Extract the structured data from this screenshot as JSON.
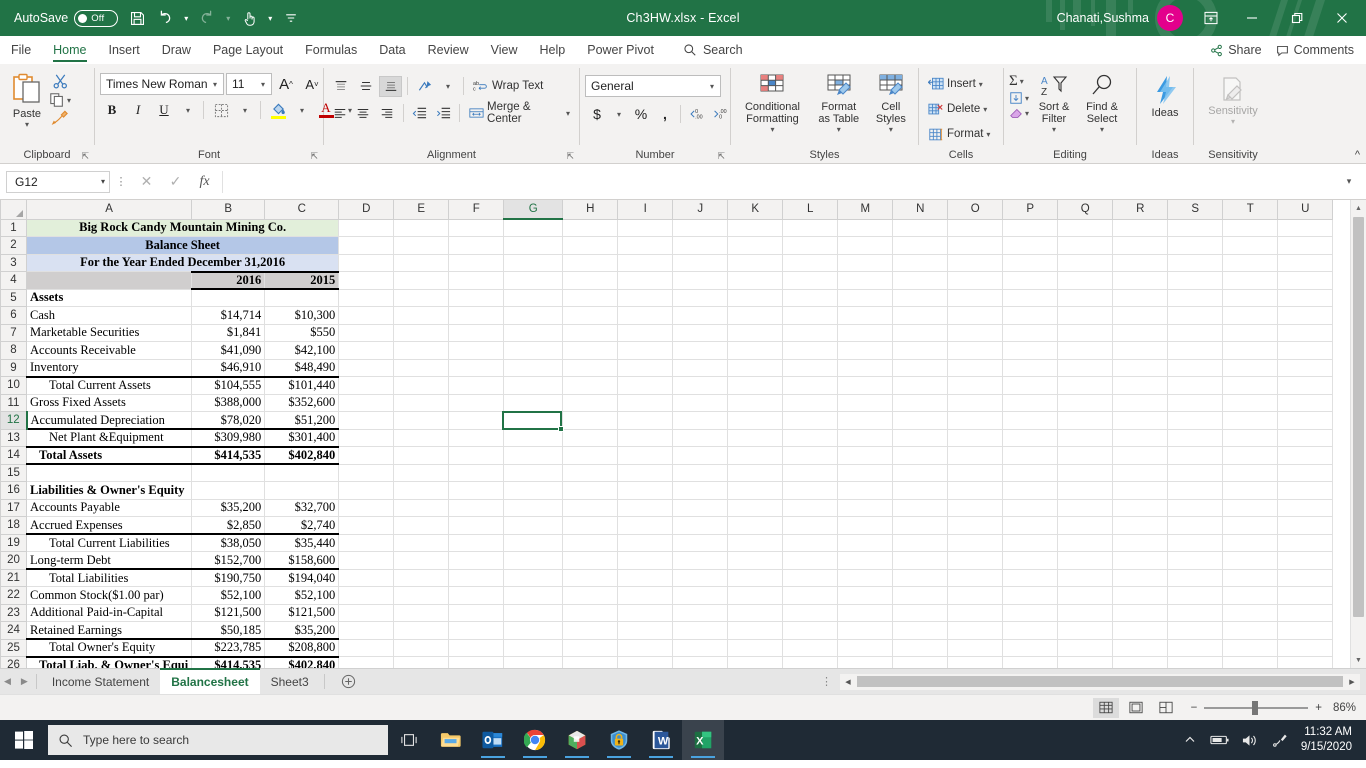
{
  "titlebar": {
    "autosave_label": "AutoSave",
    "autosave_state": "Off",
    "document_title": "Ch3HW.xlsx  -  Excel",
    "username": "Chanati,Sushma",
    "avatar_initial": "C",
    "qat": [
      {
        "name": "save-icon",
        "label": "Save"
      },
      {
        "name": "undo-icon",
        "label": "Undo"
      },
      {
        "name": "redo-icon",
        "label": "Redo"
      },
      {
        "name": "touch-mode-icon",
        "label": "Touch/Mouse Mode"
      },
      {
        "name": "customize-qat-icon",
        "label": "Customize Quick Access Toolbar"
      }
    ],
    "window_buttons": {
      "minimize": "—",
      "restore": "❐",
      "close": "✕"
    },
    "ribbon_display_label": "Ribbon Display Options",
    "accent_color": "#217346",
    "avatar_color": "#e3008c"
  },
  "ribbon_tabs": {
    "items": [
      {
        "label": "File",
        "active": false
      },
      {
        "label": "Home",
        "active": true
      },
      {
        "label": "Insert",
        "active": false
      },
      {
        "label": "Draw",
        "active": false
      },
      {
        "label": "Page Layout",
        "active": false
      },
      {
        "label": "Formulas",
        "active": false
      },
      {
        "label": "Data",
        "active": false
      },
      {
        "label": "Review",
        "active": false
      },
      {
        "label": "View",
        "active": false
      },
      {
        "label": "Help",
        "active": false
      },
      {
        "label": "Power Pivot",
        "active": false
      }
    ],
    "search_placeholder": "Search",
    "share_label": "Share",
    "comments_label": "Comments"
  },
  "ribbon": {
    "clipboard": {
      "group_label": "Clipboard",
      "paste_label": "Paste",
      "cut_label": "Cut",
      "copy_label": "Copy",
      "format_painter_label": "Format Painter"
    },
    "font": {
      "group_label": "Font",
      "font_name": "Times New Roman",
      "font_size": "11",
      "grow_label": "Increase Font Size",
      "shrink_label": "Decrease Font Size",
      "bold_label": "B",
      "italic_label": "I",
      "underline_label": "U",
      "borders_label": "Borders",
      "fill_label": "Fill Color",
      "fontcolor_label": "Font Color"
    },
    "alignment": {
      "group_label": "Alignment",
      "wrap_text_label": "Wrap Text",
      "merge_center_label": "Merge & Center",
      "orientation_label": "Orientation",
      "decrease_indent_label": "Decrease Indent",
      "increase_indent_label": "Increase Indent"
    },
    "number": {
      "group_label": "Number",
      "format": "General",
      "accounting_label": "Accounting Number Format",
      "percent_label": "Percent Style",
      "comma_label": "Comma Style",
      "increase_decimal_label": "Increase Decimal",
      "decrease_decimal_label": "Decrease Decimal"
    },
    "styles": {
      "group_label": "Styles",
      "conditional_formatting_label": "Conditional Formatting",
      "format_as_table_label": "Format as Table",
      "cell_styles_label": "Cell Styles"
    },
    "cells": {
      "group_label": "Cells",
      "insert_label": "Insert",
      "delete_label": "Delete",
      "format_label": "Format"
    },
    "editing": {
      "group_label": "Editing",
      "autosum_label": "AutoSum",
      "fill_label": "Fill",
      "clear_label": "Clear",
      "sort_filter_label": "Sort & Filter",
      "find_select_label": "Find & Select"
    },
    "ideas": {
      "group_label": "Ideas",
      "button_label": "Ideas"
    },
    "sensitivity": {
      "group_label": "Sensitivity",
      "button_label": "Sensitivity"
    }
  },
  "formula_bar": {
    "name_box": "G12",
    "cancel_label": "Cancel",
    "enter_label": "Enter",
    "fx_label": "fx",
    "formula_value": "",
    "expand_label": "Expand Formula Bar"
  },
  "grid": {
    "columns": [
      "A",
      "B",
      "C",
      "D",
      "E",
      "F",
      "G",
      "H",
      "I",
      "J",
      "K",
      "L",
      "M",
      "N",
      "O",
      "P",
      "Q",
      "R",
      "S",
      "T",
      "U"
    ],
    "selected_cell": "G12",
    "selected_column": "G",
    "selected_row": 12,
    "rows": [
      {
        "n": 1,
        "a": "Big Rock Candy Mountain Mining Co.",
        "b": "",
        "c": "",
        "style": "title-green"
      },
      {
        "n": 2,
        "a": "Balance Sheet",
        "b": "",
        "c": "",
        "style": "title-blue1"
      },
      {
        "n": 3,
        "a": "For the Year Ended December 31,2016",
        "b": "",
        "c": "",
        "style": "title-blue2"
      },
      {
        "n": 4,
        "a": "",
        "b": "2016",
        "c": "2015",
        "style": "years"
      },
      {
        "n": 5,
        "a": "Assets",
        "b": "",
        "c": "",
        "style": "section"
      },
      {
        "n": 6,
        "a": "Cash",
        "b": "$14,714",
        "c": "$10,300",
        "style": "item"
      },
      {
        "n": 7,
        "a": "Marketable Securities",
        "b": "$1,841",
        "c": "$550",
        "style": "item"
      },
      {
        "n": 8,
        "a": "Accounts Receivable",
        "b": "$41,090",
        "c": "$42,100",
        "style": "item"
      },
      {
        "n": 9,
        "a": "Inventory",
        "b": "$46,910",
        "c": "$48,490",
        "style": "item"
      },
      {
        "n": 10,
        "a": "Total Current Assets",
        "b": "$104,555",
        "c": "$101,440",
        "style": "subtotal"
      },
      {
        "n": 11,
        "a": "Gross Fixed Assets",
        "b": "$388,000",
        "c": "$352,600",
        "style": "item"
      },
      {
        "n": 12,
        "a": "Accumulated Depreciation",
        "b": "$78,020",
        "c": "$51,200",
        "style": "item"
      },
      {
        "n": 13,
        "a": "Net Plant &Equipment",
        "b": "$309,980",
        "c": "$301,400",
        "style": "subtotal"
      },
      {
        "n": 14,
        "a": "Total Assets",
        "b": "$414,535",
        "c": "$402,840",
        "style": "grandtotal"
      },
      {
        "n": 15,
        "a": "",
        "b": "",
        "c": "",
        "style": "blank"
      },
      {
        "n": 16,
        "a": "Liabilities & Owner's Equity",
        "b": "",
        "c": "",
        "style": "section"
      },
      {
        "n": 17,
        "a": "Accounts Payable",
        "b": "$35,200",
        "c": "$32,700",
        "style": "item"
      },
      {
        "n": 18,
        "a": "Accrued Expenses",
        "b": "$2,850",
        "c": "$2,740",
        "style": "item"
      },
      {
        "n": 19,
        "a": "Total Current Liabilities",
        "b": "$38,050",
        "c": "$35,440",
        "style": "subtotal"
      },
      {
        "n": 20,
        "a": "Long-term Debt",
        "b": "$152,700",
        "c": "$158,600",
        "style": "item"
      },
      {
        "n": 21,
        "a": "Total Liabilities",
        "b": "$190,750",
        "c": "$194,040",
        "style": "subtotal"
      },
      {
        "n": 22,
        "a": "Common Stock($1.00 par)",
        "b": "$52,100",
        "c": "$52,100",
        "style": "item"
      },
      {
        "n": 23,
        "a": "Additional Paid-in-Capital",
        "b": "$121,500",
        "c": "$121,500",
        "style": "item"
      },
      {
        "n": 24,
        "a": "Retained Earnings",
        "b": "$50,185",
        "c": "$35,200",
        "style": "item"
      },
      {
        "n": 25,
        "a": "Total Owner's Equity",
        "b": "$223,785",
        "c": "$208,800",
        "style": "subtotal"
      },
      {
        "n": 26,
        "a": "Total Liab. & Owner's Equi",
        "b": "$414,535",
        "c": "$402,840",
        "style": "grandtotal"
      }
    ]
  },
  "sheet_tabs": {
    "items": [
      {
        "label": "Income Statement",
        "active": false
      },
      {
        "label": "Balancesheet",
        "active": true
      },
      {
        "label": "Sheet3",
        "active": false
      }
    ],
    "add_sheet_label": "+",
    "prev_label": "◀",
    "next_label": "▶"
  },
  "status_bar": {
    "normal_view_label": "Normal",
    "page_layout_label": "Page Layout",
    "page_break_label": "Page Break Preview",
    "zoom_out_label": "−",
    "zoom_in_label": "+",
    "zoom_level": "86%"
  },
  "taskbar": {
    "start_label": "Start",
    "search_placeholder": "Type here to search",
    "task_view_label": "Task View",
    "apps": [
      {
        "name": "file-explorer-icon",
        "label": "File Explorer",
        "running": false
      },
      {
        "name": "outlook-icon",
        "label": "Outlook",
        "running": true
      },
      {
        "name": "chrome-icon",
        "label": "Google Chrome",
        "running": true
      },
      {
        "name": "cube-app-icon",
        "label": "3D Viewer",
        "running": true
      },
      {
        "name": "security-lock-icon",
        "label": "Security",
        "running": true
      },
      {
        "name": "word-icon",
        "label": "Word",
        "running": true
      },
      {
        "name": "excel-icon",
        "label": "Excel",
        "running": true,
        "active": true
      }
    ],
    "tray": [
      {
        "name": "show-hidden-icons-icon",
        "label": "Show hidden icons"
      },
      {
        "name": "battery-icon",
        "label": "Battery"
      },
      {
        "name": "volume-icon",
        "label": "Volume"
      },
      {
        "name": "pen-icon",
        "label": "Windows Ink"
      }
    ],
    "time": "11:32 AM",
    "date": "9/15/2020"
  }
}
